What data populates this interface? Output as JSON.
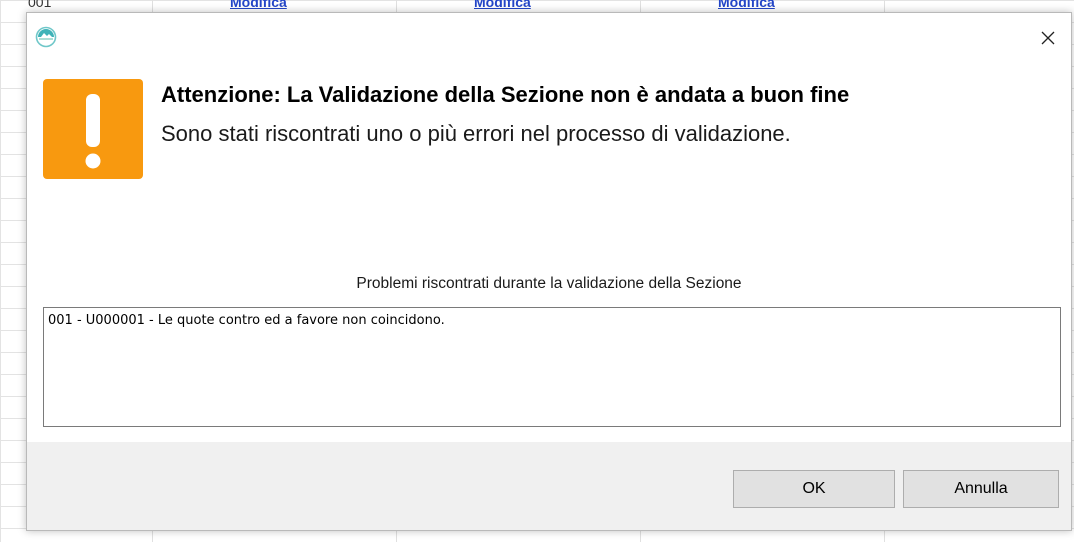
{
  "background": {
    "partial_text": "001",
    "links": [
      "Modifica",
      "Modifica",
      "Modifica"
    ]
  },
  "dialog": {
    "app_icon": "app-logo-icon",
    "close_icon": "close-icon",
    "warning_icon": "exclamation-warning-icon",
    "title": "Attenzione: La Validazione della Sezione non è andata a buon fine",
    "subtitle": "Sono stati riscontrati uno o più errori nel processo di validazione.",
    "problems_label": "Problemi riscontrati durante la validazione della Sezione",
    "problems": [
      "001 - U000001 - Le quote contro ed a favore non coincidono."
    ],
    "buttons": {
      "ok": "OK",
      "cancel": "Annulla"
    }
  },
  "colors": {
    "warning": "#f8990f",
    "footer_bg": "#f0f0f0",
    "button_bg": "#e1e1e1",
    "link": "#2446c8"
  }
}
